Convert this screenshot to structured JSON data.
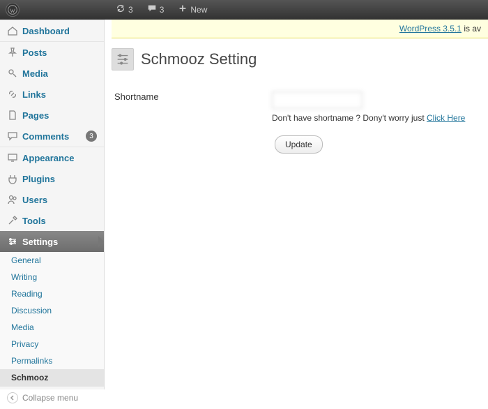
{
  "adminbar": {
    "refresh_count": "3",
    "comments_count": "3",
    "new_label": "New"
  },
  "notice": {
    "link_text": "WordPress 3.5.1",
    "suffix": " is av"
  },
  "sidebar": {
    "dashboard": "Dashboard",
    "posts": "Posts",
    "media": "Media",
    "links": "Links",
    "pages": "Pages",
    "comments": "Comments",
    "comments_count": "3",
    "appearance": "Appearance",
    "plugins": "Plugins",
    "users": "Users",
    "tools": "Tools",
    "settings": "Settings",
    "collapse": "Collapse menu",
    "submenu": {
      "general": "General",
      "writing": "Writing",
      "reading": "Reading",
      "discussion": "Discussion",
      "media": "Media",
      "privacy": "Privacy",
      "permalinks": "Permalinks",
      "schmooz": "Schmooz"
    }
  },
  "page": {
    "title": "Schmooz Setting",
    "shortname_label": "Shortname",
    "shortname_value": "",
    "helper_prefix": "Don't have shortname ? Dony't worry just ",
    "helper_link": "Click Here",
    "update_label": "Update"
  }
}
